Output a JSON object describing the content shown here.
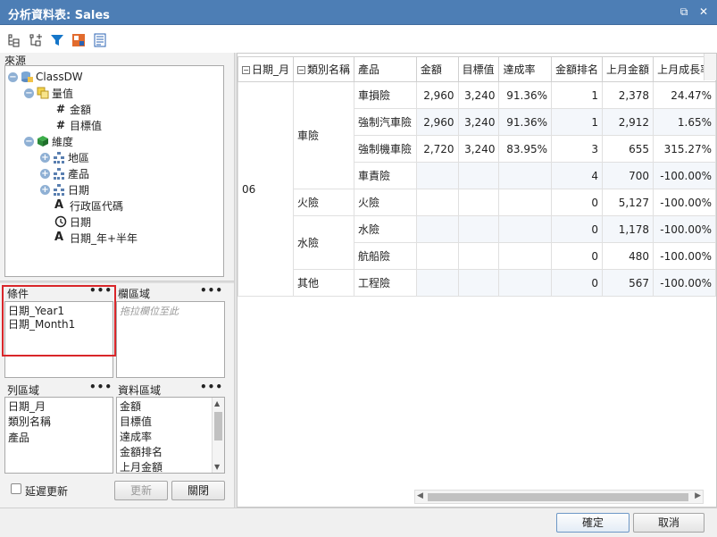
{
  "window": {
    "title": "分析資料表: Sales"
  },
  "source": {
    "label": "來源",
    "root": "ClassDW",
    "measures_group": "量值",
    "measures": [
      "金額",
      "目標值"
    ],
    "dimensions_group": "維度",
    "dimensions": [
      "地區",
      "產品",
      "日期"
    ],
    "attributes": [
      "行政區代碼",
      "日期",
      "日期_年+半年"
    ]
  },
  "zones": {
    "filters": {
      "label": "條件",
      "items": [
        "日期_Year1",
        "日期_Month1"
      ]
    },
    "columns": {
      "label": "欄區域",
      "hint": "拖拉欄位至此"
    },
    "rows": {
      "label": "列區域",
      "items": [
        "日期_月",
        "類別名稱",
        "產品"
      ]
    },
    "data": {
      "label": "資料區域",
      "items": [
        "金額",
        "目標值",
        "達成率",
        "金額排名",
        "上月金額"
      ]
    },
    "more": "•••"
  },
  "left_footer": {
    "defer_label": "延遲更新",
    "update_label": "更新",
    "close_label": "關閉"
  },
  "pivot": {
    "headers": [
      "日期_月",
      "類別名稱",
      "產品",
      "金額",
      "目標值",
      "達成率",
      "金額排名",
      "上月金額",
      "上月成長率"
    ],
    "month": "06",
    "categories": [
      "車險",
      "火險",
      "水險",
      "其他"
    ],
    "rows": [
      {
        "product": "車損險",
        "amount": "2,960",
        "target": "3,240",
        "rate": "91.36%",
        "rank": "1",
        "prev": "2,378",
        "growth": "24.47%"
      },
      {
        "product": "強制汽車險",
        "amount": "2,960",
        "target": "3,240",
        "rate": "91.36%",
        "rank": "1",
        "prev": "2,912",
        "growth": "1.65%"
      },
      {
        "product": "強制機車險",
        "amount": "2,720",
        "target": "3,240",
        "rate": "83.95%",
        "rank": "3",
        "prev": "655",
        "growth": "315.27%"
      },
      {
        "product": "車責險",
        "amount": "",
        "target": "",
        "rate": "",
        "rank": "4",
        "prev": "700",
        "growth": "-100.00%"
      },
      {
        "product": "火險",
        "amount": "",
        "target": "",
        "rate": "",
        "rank": "0",
        "prev": "5,127",
        "growth": "-100.00%"
      },
      {
        "product": "水險",
        "amount": "",
        "target": "",
        "rate": "",
        "rank": "0",
        "prev": "1,178",
        "growth": "-100.00%"
      },
      {
        "product": "航船險",
        "amount": "",
        "target": "",
        "rate": "",
        "rank": "0",
        "prev": "480",
        "growth": "-100.00%"
      },
      {
        "product": "工程險",
        "amount": "",
        "target": "",
        "rate": "",
        "rank": "0",
        "prev": "567",
        "growth": "-100.00%"
      }
    ]
  },
  "footer": {
    "ok_label": "確定",
    "cancel_label": "取消"
  },
  "colors": {
    "titlebar": "#4d7eb5",
    "highlight": "#d9262a",
    "alt_row": "#f4f7fb"
  }
}
